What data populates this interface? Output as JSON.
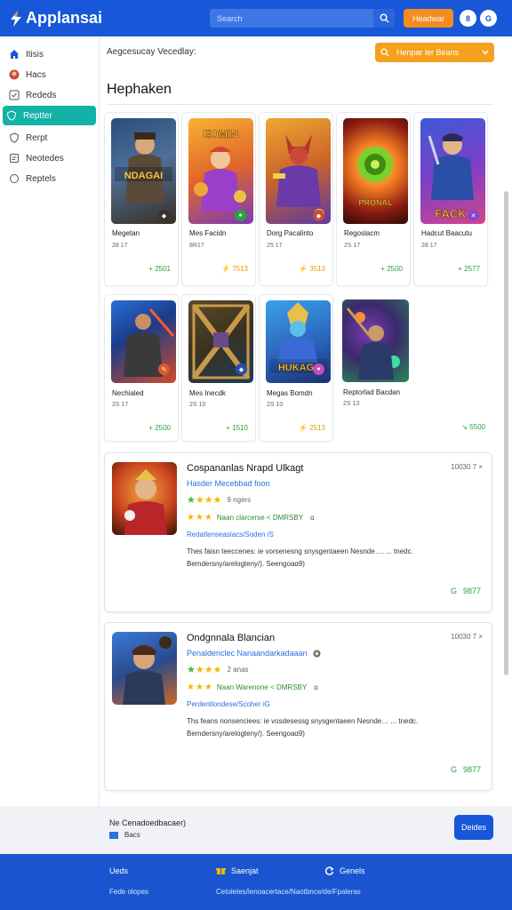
{
  "header": {
    "app_name": "Applansai",
    "search_placeholder": "Search",
    "action_label": "Headwar",
    "circle_1": "8",
    "circle_2": "G"
  },
  "sidebar": {
    "items": [
      {
        "label": "Itisis"
      },
      {
        "label": "Hacs"
      },
      {
        "label": "Rededs"
      },
      {
        "label": "Reptter"
      },
      {
        "label": "Rerpt"
      },
      {
        "label": "Neotedes"
      },
      {
        "label": "Reptels"
      }
    ]
  },
  "main": {
    "breadcrumb": "Aegcesucay Vecedlay:",
    "filter_label": "Henpar ler Beans",
    "section_title": "Hephaken"
  },
  "games_row1": [
    {
      "name": "Megetan",
      "sub": "28 17",
      "price": "2501",
      "price_icon": "+",
      "art_text": "NDAGAI"
    },
    {
      "name": "Mes Facidn",
      "sub": "8R17",
      "price": "7513",
      "price_icon": "⚡",
      "art_text": "EOMIN"
    },
    {
      "name": "Dorg Pacalinto",
      "sub": "25 17",
      "price": "3513",
      "price_icon": "⚡",
      "art_text": ""
    },
    {
      "name": "Regoslacm",
      "sub": "2S 17",
      "price": "2500",
      "price_icon": "+",
      "art_text": "PRONAL"
    },
    {
      "name": "Hadcut Baacutu",
      "sub": "28 17",
      "price": "2577",
      "price_icon": "+",
      "art_text": "FACK"
    }
  ],
  "games_row2": [
    {
      "name": "Nechialed",
      "sub": "2S 17",
      "price": "2500",
      "price_icon": "+",
      "art_text": ""
    },
    {
      "name": "Mes Inecdk",
      "sub": "2S 10",
      "price": "1510",
      "price_icon": "+",
      "art_text": ""
    },
    {
      "name": "Megas Bomdn",
      "sub": "2S 10",
      "price": "2513",
      "price_icon": "⚡",
      "art_text": "HUKAG"
    },
    {
      "name": "Reptorlad Bacdan",
      "sub": "2S 13",
      "price": "",
      "price_icon": "",
      "art_text": ""
    },
    {
      "name": "",
      "sub": "",
      "price": "5500",
      "price_icon": "↘",
      "art_text": ""
    }
  ],
  "reviews": [
    {
      "title": "Cospananlas Nrapd Ulkagt",
      "time": "10030 7 ×",
      "subtitle": "Hasder Mecebbad foon",
      "star_count": "9 ngers",
      "meta": "Naan clarcerse < DMRSBY",
      "meta_icon": "ɑ",
      "link": "Redatlenseaslacs/Soden iS",
      "body": "Thes faisn teeccenes: ie vorsenesng snysgentaeen Nesnde…. ... tnedc. Bemdersny/arelogteny/). Seengoa",
      "body_end": "ɑ9)",
      "price": "9877",
      "price_icon": "G"
    },
    {
      "title": "Ondgnnala Blancian",
      "time": "10030 7 ×",
      "subtitle": "Penaldenclec Nanaandarkadaaan",
      "star_count": "2 anas",
      "meta": "Naan Warenone < DMRSBY",
      "meta_icon": "ɑ",
      "link": "Perdentlondese/Scoher iG",
      "body": "Ths feans nonsenciees: ie vosdesessg snysgentaeen Nesnde… ... tnedc. Bemdersny/arelogteny/). Seengoa",
      "body_end": "ɑ9)",
      "price": "9877",
      "price_icon": "G"
    }
  ],
  "bottom": {
    "line1": "Ne Cenadoedbacaer)",
    "line2": "Bacs",
    "cta": "Deides"
  },
  "footer": {
    "col1_label": "Ueds",
    "col2_label": "Saenjat",
    "col3_label": "Genels",
    "small_left": "Fede olopes",
    "small_right": "Cetoletes/lenoacertace/Naotbnce/de/Fpaleras"
  },
  "colors": {
    "brand_blue": "#1757d8",
    "accent_orange": "#f48c1f",
    "active_teal": "#12b3a6",
    "price_green": "#2aa33b"
  }
}
